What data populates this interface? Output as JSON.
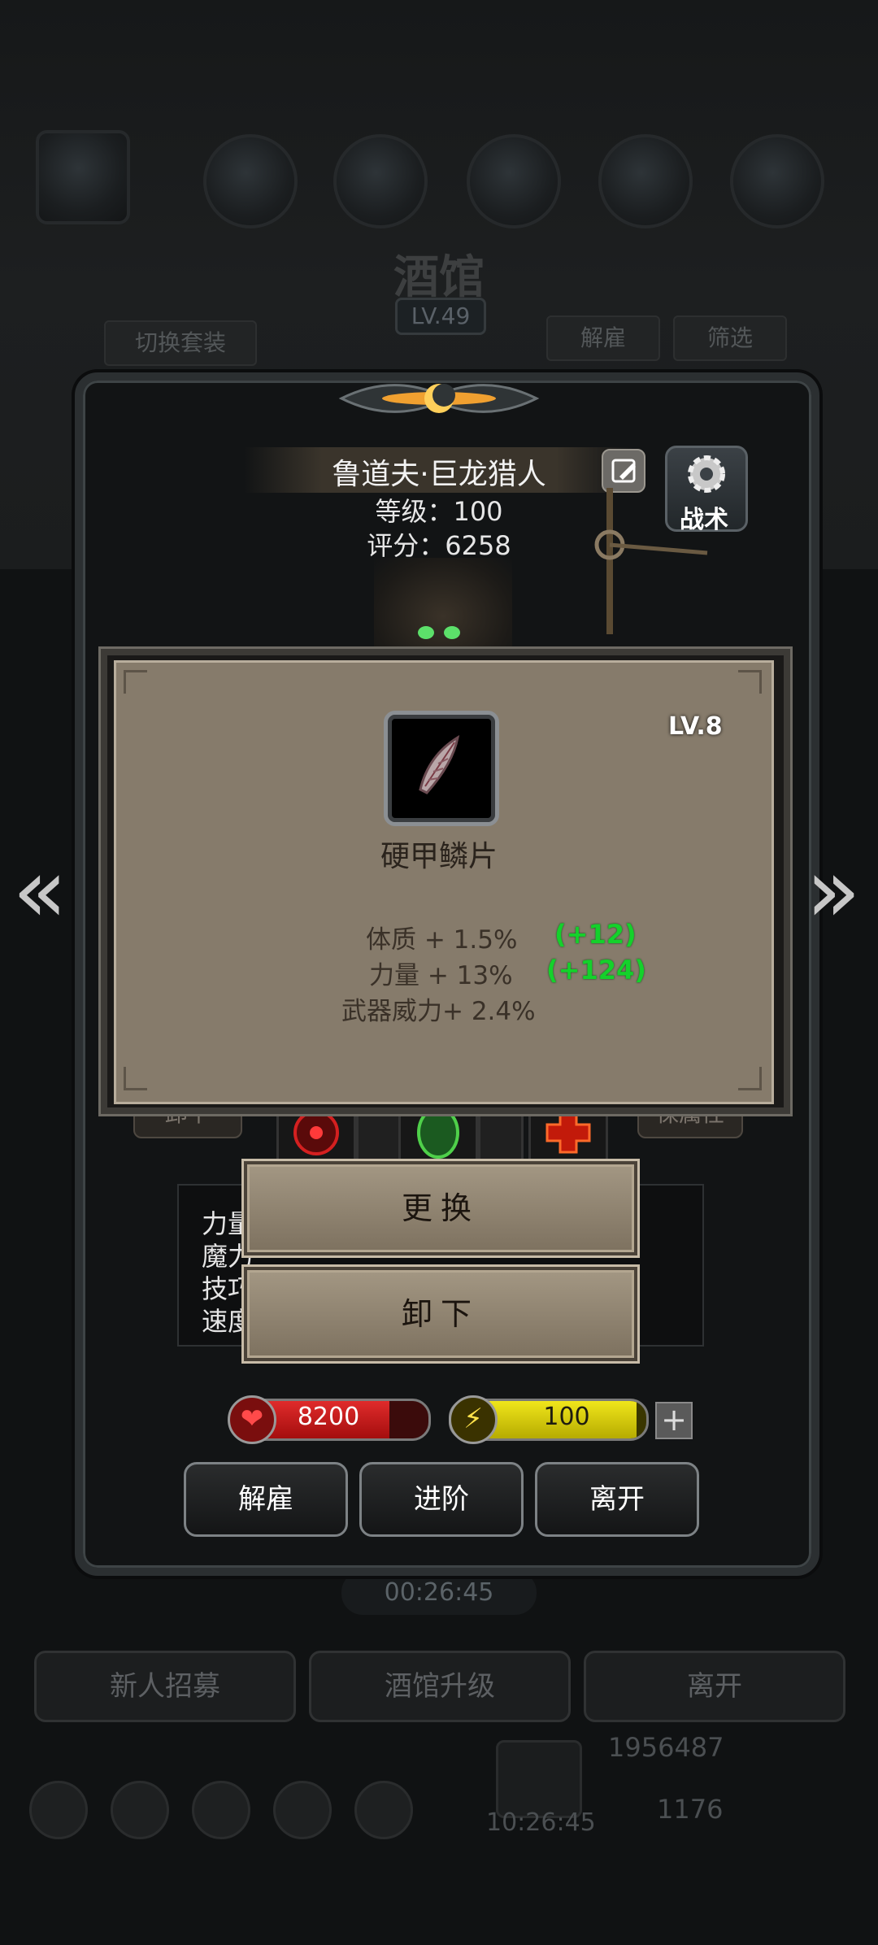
{
  "background": {
    "title": "酒馆",
    "level": "LV.49",
    "switch_outfit": "切换套装",
    "dismiss": "解雇",
    "filter": "筛选",
    "timer": "00:26:45",
    "recruit": "新人招募",
    "upgrade": "酒馆升级",
    "leave": "离开",
    "gold": "1956487",
    "gems": "1176",
    "clock": "10:26:45"
  },
  "hero": {
    "name": "鲁道夫·巨龙猎人",
    "level_text": "等级：100",
    "score_text": "评分：6258",
    "tactics_label": "战术",
    "side_left": "卸下",
    "side_right": "保属性",
    "stats_col1": [
      "力量",
      "魔力",
      "技巧",
      "速度"
    ],
    "hp": "8200",
    "energy": "100",
    "energy_fill": 0.95,
    "hp_fill": 0.8
  },
  "panel_buttons": {
    "dismiss": "解雇",
    "advance": "进阶",
    "leave": "离开"
  },
  "item_popup": {
    "level": "LV.8",
    "name": "硬甲鳞片",
    "stats": [
      {
        "text": "体质 + 1.5%",
        "bonus": "(+12)"
      },
      {
        "text": "力量 + 13%",
        "bonus": "(+124)"
      },
      {
        "text": "武器威力+ 2.4%",
        "bonus": ""
      }
    ]
  },
  "actions": {
    "replace": "更换",
    "unequip": "卸下"
  },
  "nav": {
    "prev": "«",
    "next": "»"
  },
  "colors": {
    "bonus_green": "#14d12b",
    "hp_red": "#e02b2b",
    "energy_yellow": "#f0e61b",
    "popup_bg": "#867b6b"
  }
}
